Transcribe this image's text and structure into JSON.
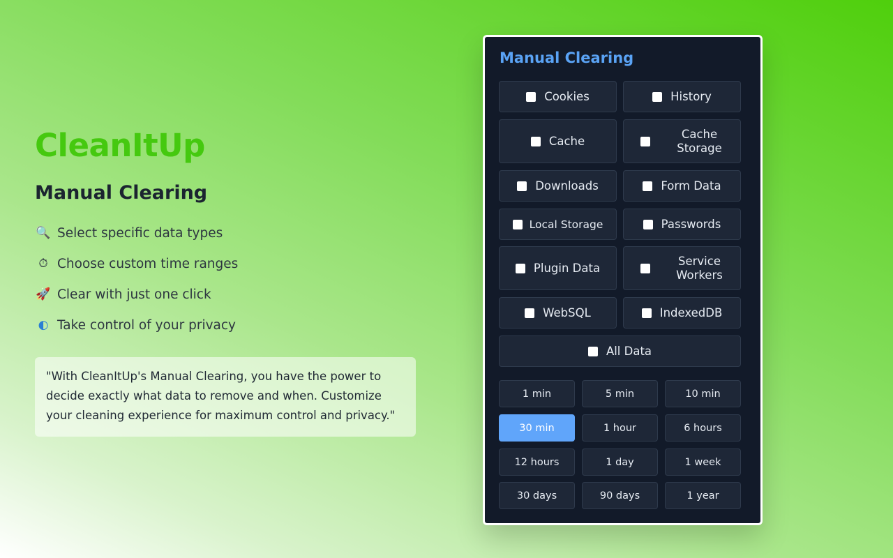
{
  "promo": {
    "brand": "CleanItUp",
    "subtitle": "Manual Clearing",
    "features": [
      {
        "icon": "magnifier-icon",
        "glyph": "🔍",
        "text": "Select specific data types"
      },
      {
        "icon": "stopwatch-icon",
        "glyph": "⏱",
        "text": "Choose custom time ranges"
      },
      {
        "icon": "rocket-icon",
        "glyph": "🚀",
        "text": "Clear with just one click"
      },
      {
        "icon": "shield-icon",
        "glyph": "◐",
        "text": "Take control of your privacy"
      }
    ],
    "quote": "\"With CleanItUp's Manual Clearing, you have the power to decide exactly what data to remove and when. Customize your cleaning experience for maximum control and privacy.\""
  },
  "panel": {
    "title": "Manual Clearing",
    "data_types": [
      {
        "label": "Cookies",
        "checked": false
      },
      {
        "label": "History",
        "checked": false
      },
      {
        "label": "Cache",
        "checked": false
      },
      {
        "label": "Cache Storage",
        "checked": false
      },
      {
        "label": "Downloads",
        "checked": false
      },
      {
        "label": "Form Data",
        "checked": false
      },
      {
        "label": "Local Storage",
        "checked": false
      },
      {
        "label": "Passwords",
        "checked": false
      },
      {
        "label": "Plugin Data",
        "checked": false
      },
      {
        "label": "Service Workers",
        "checked": false
      },
      {
        "label": "WebSQL",
        "checked": false
      },
      {
        "label": "IndexedDB",
        "checked": false
      },
      {
        "label": "All Data",
        "checked": false
      }
    ],
    "time_ranges": [
      "1 min",
      "5 min",
      "10 min",
      "30 min",
      "1 hour",
      "6 hours",
      "12 hours",
      "1 day",
      "1 week",
      "30 days",
      "90 days",
      "1 year"
    ],
    "selected_time_range": "30 min"
  },
  "colors": {
    "brand_green": "#45c90f",
    "panel_bg": "#121a29",
    "panel_title": "#5aa3f5",
    "accent_blue": "#60a5fa"
  }
}
